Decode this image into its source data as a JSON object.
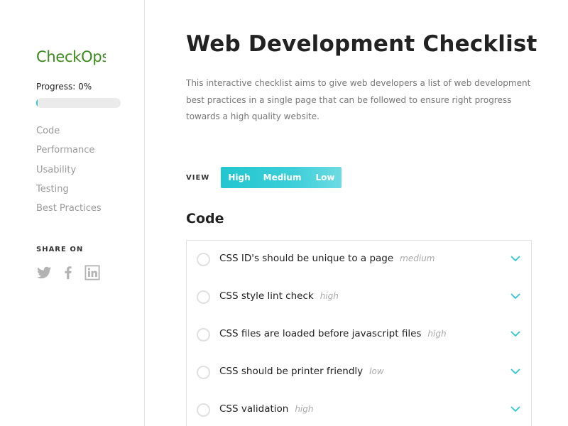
{
  "sidebar": {
    "logo": "CheckOps",
    "progress_label": "Progress: 0%",
    "progress_value": 0,
    "nav": [
      "Code",
      "Performance",
      "Usability",
      "Testing",
      "Best Practices"
    ],
    "share_label": "SHARE ON",
    "social_icons": [
      "twitter-icon",
      "facebook-icon",
      "linkedin-icon"
    ]
  },
  "main": {
    "title": "Web Development Checklist",
    "intro": "This interactive checklist aims to give web developers a list of web development best practices in a single page that can be followed to ensure right progress towards a high quality website.",
    "view_label": "VIEW",
    "view_options": [
      "High",
      "Medium",
      "Low"
    ],
    "section_title": "Code",
    "items": [
      {
        "text": "CSS ID's should be unique to a page",
        "priority": "medium"
      },
      {
        "text": "CSS style lint check",
        "priority": "high"
      },
      {
        "text": "CSS files are loaded before javascript files",
        "priority": "high"
      },
      {
        "text": "CSS should be printer friendly",
        "priority": "low"
      },
      {
        "text": "CSS validation",
        "priority": "high"
      }
    ]
  },
  "colors": {
    "accent": "#22c6cf",
    "logo": "#3c8a1e",
    "nav_text": "#9a9a9a"
  }
}
